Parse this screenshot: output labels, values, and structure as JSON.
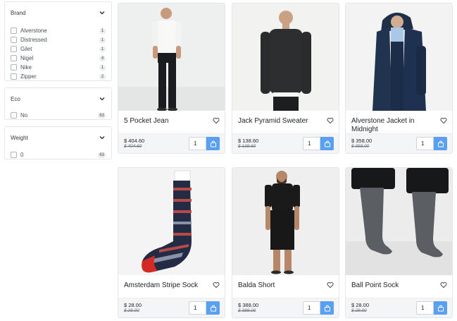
{
  "filters": {
    "brand": {
      "title": "Brand",
      "options": [
        {
          "label": "Alverstone",
          "count": "1"
        },
        {
          "label": "Distressed",
          "count": "1"
        },
        {
          "label": "Gilet",
          "count": "1"
        },
        {
          "label": "Nigel",
          "count": "4"
        },
        {
          "label": "Nike",
          "count": "1"
        },
        {
          "label": "Zipper",
          "count": "2"
        }
      ]
    },
    "eco": {
      "title": "Eco",
      "options": [
        {
          "label": "No",
          "count": "63"
        }
      ]
    },
    "weight": {
      "title": "Weight",
      "options": [
        {
          "label": "0",
          "count": "63"
        }
      ]
    }
  },
  "products": [
    {
      "name": "5 Pocket Jean",
      "price": "$ 404.60",
      "old_price": "$ 404.60",
      "qty": "1",
      "image": "man-white-tee-black-jeans"
    },
    {
      "name": "Jack Pyramid Sweater",
      "price": "$ 138.60",
      "old_price": "$ 138.60",
      "qty": "1",
      "image": "man-dark-sweater"
    },
    {
      "name": "Alverstone Jacket in Midnight",
      "price": "$ 358.00",
      "old_price": "$ 358.00",
      "qty": "1",
      "image": "man-navy-jacket"
    },
    {
      "name": "Amsterdam Stripe Sock",
      "price": "$ 28.00",
      "old_price": "$ 28.00",
      "qty": "1",
      "image": "striped-sock"
    },
    {
      "name": "Balda Short",
      "price": "$ 388.00",
      "old_price": "$ 388.00",
      "qty": "1",
      "image": "man-black-shorts"
    },
    {
      "name": "Ball Point Sock",
      "price": "$ 28.00",
      "old_price": "$ 28.00",
      "qty": "1",
      "image": "grey-socks-legs"
    }
  ],
  "colors": {
    "accent": "#5aa0f2",
    "border": "#e3e6ea",
    "footer_bg": "#f4f5f6"
  }
}
